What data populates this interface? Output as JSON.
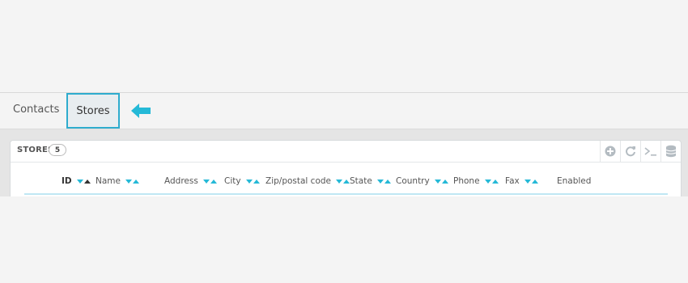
{
  "tabs": [
    {
      "label": "Contacts",
      "active": false
    },
    {
      "label": "Stores",
      "active": true
    }
  ],
  "accent_color": "#2eacce",
  "callout_icon": "arrow-left-icon",
  "panel": {
    "title": "STORES",
    "count": "5",
    "tools": [
      "add-new-icon",
      "refresh-icon",
      "sql-query-icon",
      "sql-manager-icon"
    ]
  },
  "table": {
    "columns": [
      {
        "label": "ID",
        "sortable": true,
        "sorted": "asc"
      },
      {
        "label": "Name",
        "sortable": true
      },
      {
        "label": "Address",
        "sortable": true
      },
      {
        "label": "City",
        "sortable": true
      },
      {
        "label": "Zip/postal code",
        "sortable": true
      },
      {
        "label": "State",
        "sortable": true
      },
      {
        "label": "Country",
        "sortable": true
      },
      {
        "label": "Phone",
        "sortable": true
      },
      {
        "label": "Fax",
        "sortable": true
      },
      {
        "label": "Enabled",
        "sortable": false
      }
    ]
  }
}
